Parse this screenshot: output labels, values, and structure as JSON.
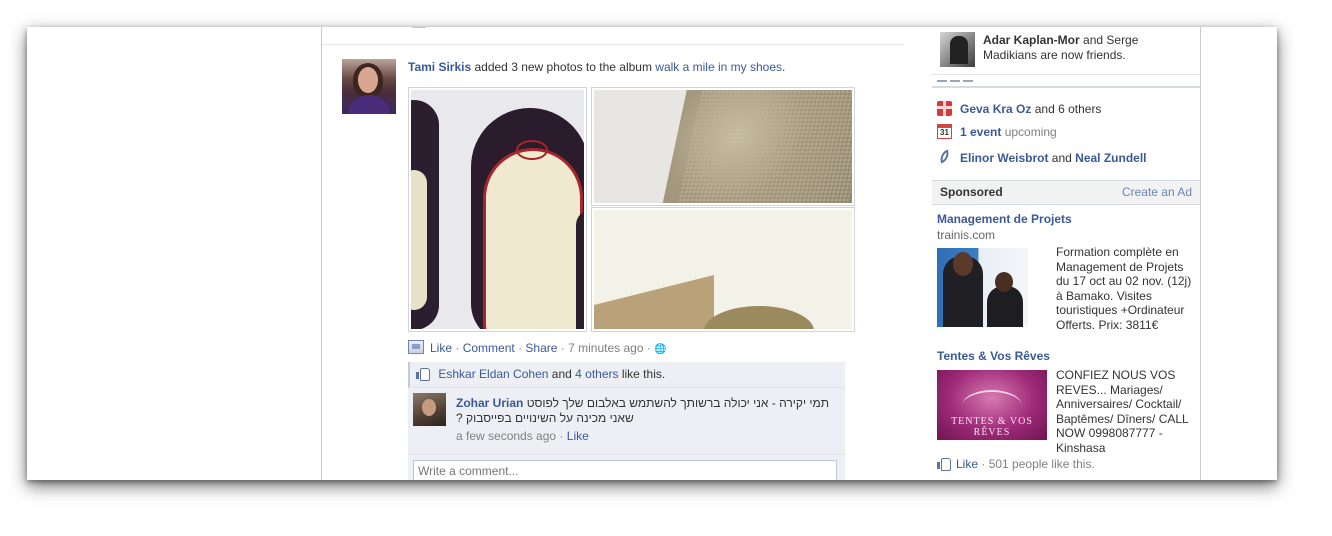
{
  "story": {
    "actor": "Tami Sirkis",
    "action_text": "added 3 new photos to the album",
    "album_name": "walk a mile in my shoes",
    "period": "."
  },
  "actions": {
    "like": "Like",
    "comment": "Comment",
    "share": "Share",
    "time": "7 minutes ago",
    "sep": "·",
    "globe": "🌐"
  },
  "likes": {
    "name": "Eshkar Eldan Cohen",
    "and": "and",
    "others": "4 others",
    "suffix": "like this."
  },
  "comment": {
    "author": "Zohar Urian",
    "text": "תמי יקירה - אני יכולה ברשותך להשתמש באלבום שלך לפוסט שאני מכינה על השינויים בפייסבוק ?",
    "time": "a few seconds ago",
    "like": "Like"
  },
  "write_comment": {
    "placeholder": "Write a comment..."
  },
  "right_column": {
    "friends": {
      "name1": "Adar Kaplan-Mor",
      "and": "and Serge",
      "line2": "Madikians are now friends."
    },
    "birthdays": {
      "name": "Geva Kra Oz",
      "rest": "and 6 others"
    },
    "events": {
      "count": "1 event",
      "rest": "upcoming"
    },
    "pokes": {
      "name1": "Elinor Weisbrot",
      "and": "and",
      "name2": "Neal Zundell"
    },
    "sponsored": {
      "title": "Sponsored",
      "create": "Create an Ad"
    },
    "ads": [
      {
        "title": "Management de Projets",
        "domain": "trainis.com",
        "text": "Formation complète en Management de Projets du 17 oct au 02 nov. (12j) à Bamako. Visites touristiques +Ordinateur Offerts. Prix: 3811€"
      },
      {
        "title": "Tentes & Vos Rêves",
        "image_text": "TENTES & VOS RÊVES",
        "text": "CONFIEZ NOUS VOS REVES... Mariages/ Anniversaires/ Cocktail/ Baptêmes/ Dîners/ CALL NOW 0998087777 - Kinshasa",
        "like": "Like",
        "like_count": "501 people like this."
      }
    ]
  },
  "colors": {
    "link": "#3b5998",
    "ufi_bg": "#edeff4",
    "border": "#c6cbd6"
  }
}
